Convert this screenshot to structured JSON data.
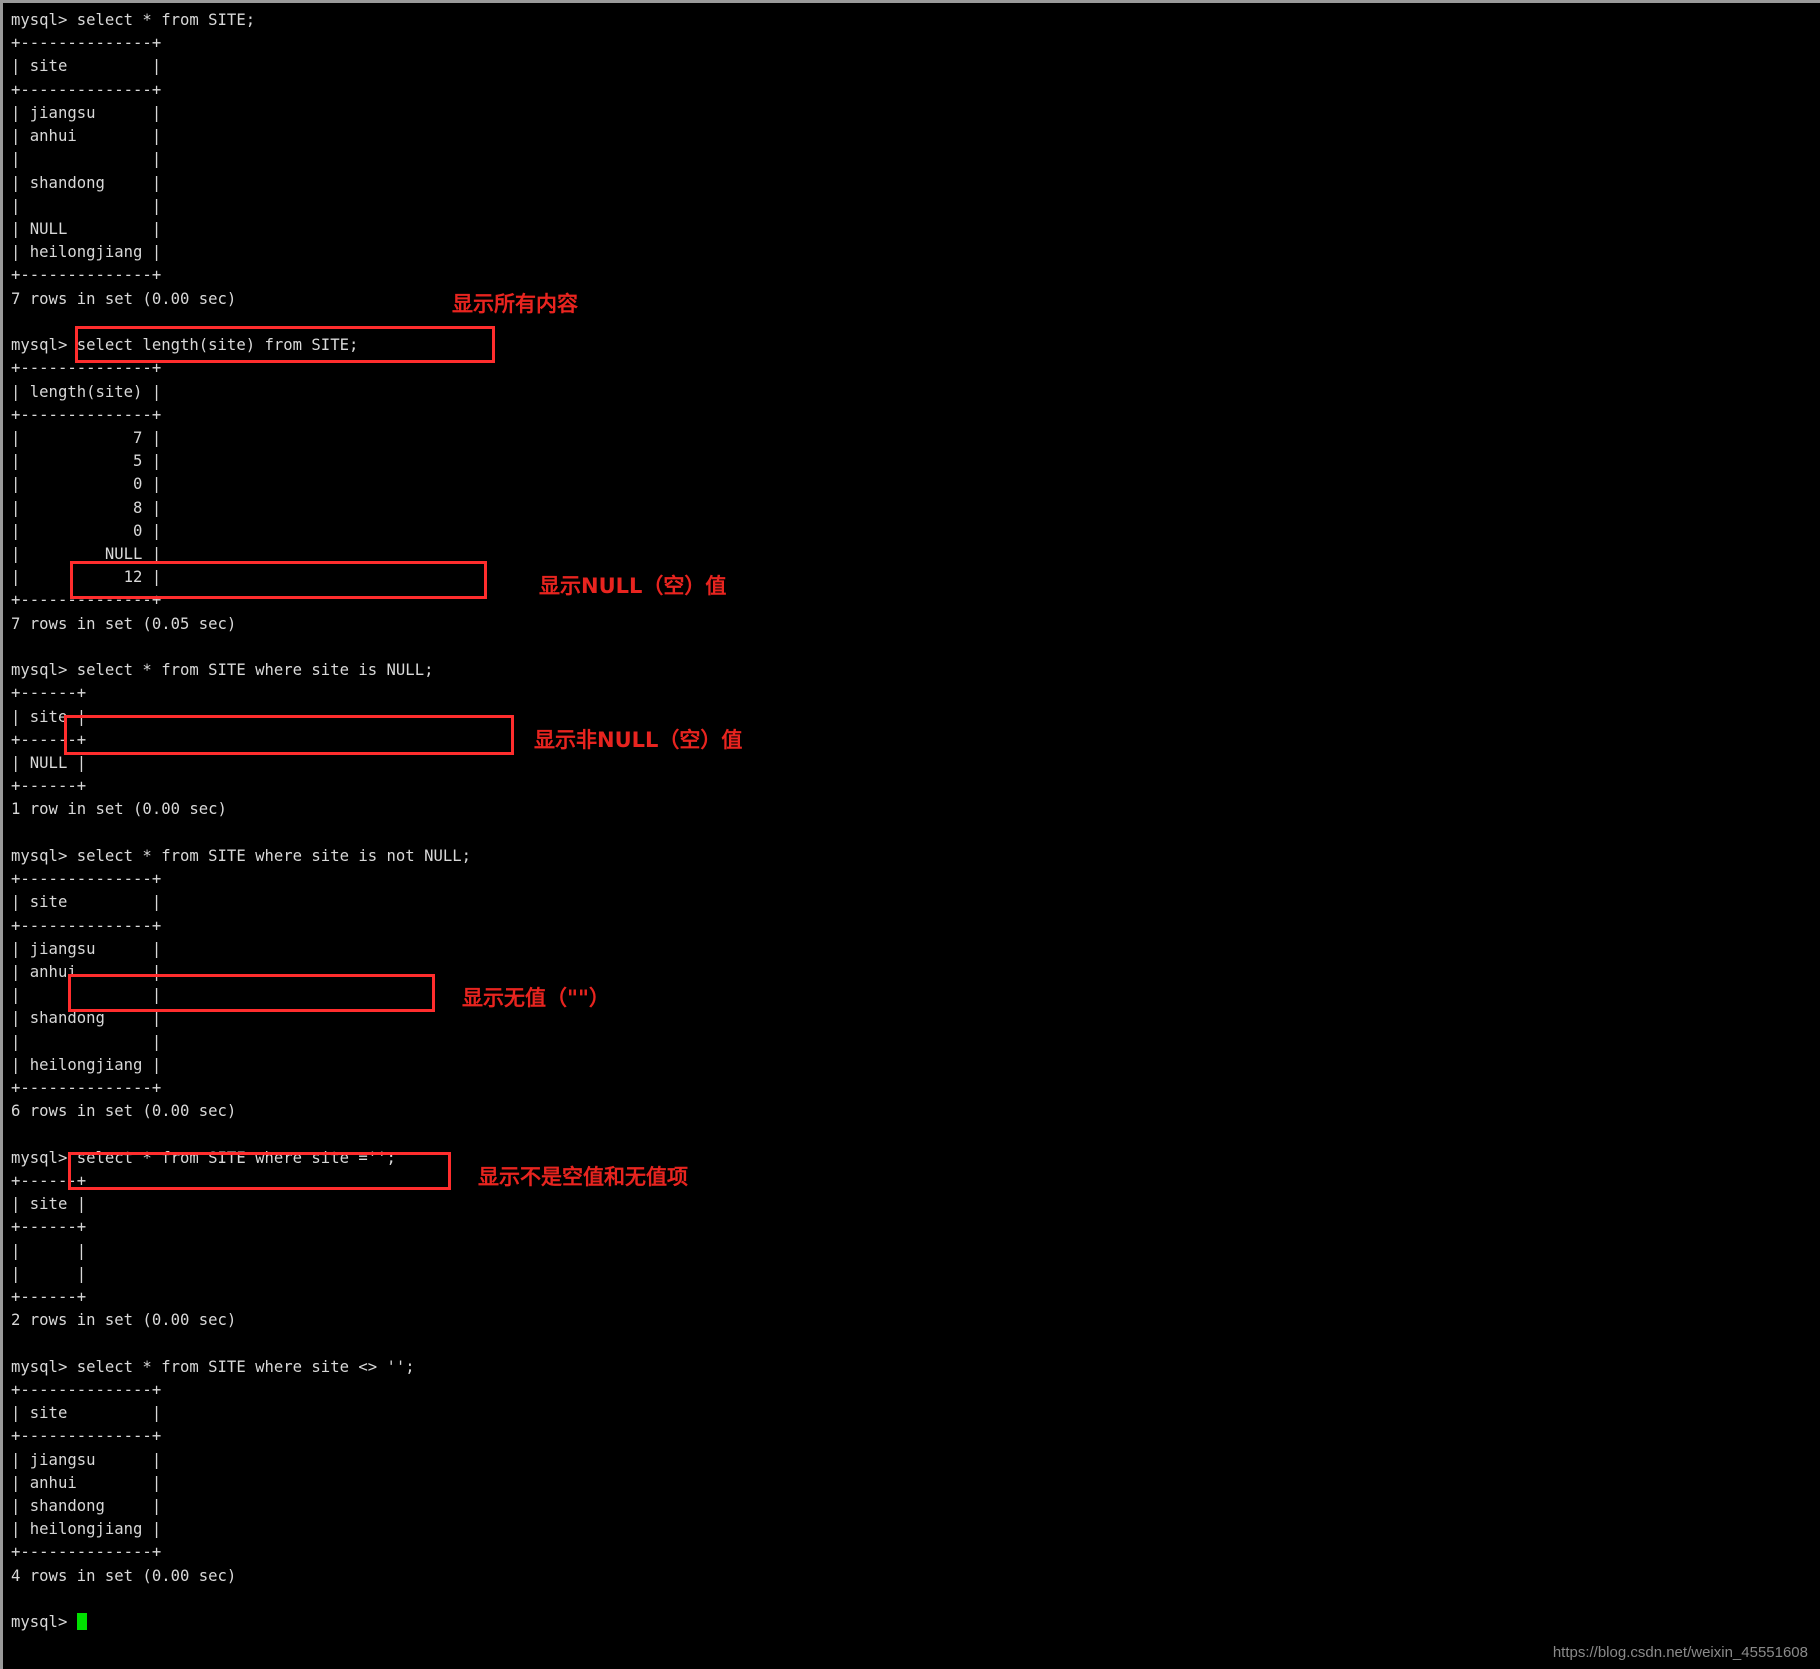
{
  "terminal": {
    "prompt": "mysql>",
    "cursor": "block-cursor",
    "lines": [
      "mysql> select * from SITE;",
      "+--------------+",
      "| site         |",
      "+--------------+",
      "| jiangsu      |",
      "| anhui        |",
      "|              |",
      "| shandong     |",
      "|              |",
      "| NULL         |",
      "| heilongjiang |",
      "+--------------+",
      "7 rows in set (0.00 sec)",
      "",
      "mysql> select length(site) from SITE;",
      "+--------------+",
      "| length(site) |",
      "+--------------+",
      "|            7 |",
      "|            5 |",
      "|            0 |",
      "|            8 |",
      "|            0 |",
      "|         NULL |",
      "|           12 |",
      "+--------------+",
      "7 rows in set (0.05 sec)",
      "",
      "mysql> select * from SITE where site is NULL;",
      "+------+",
      "| site |",
      "+------+",
      "| NULL |",
      "+------+",
      "1 row in set (0.00 sec)",
      "",
      "mysql> select * from SITE where site is not NULL;",
      "+--------------+",
      "| site         |",
      "+--------------+",
      "| jiangsu      |",
      "| anhui        |",
      "|              |",
      "| shandong     |",
      "|              |",
      "| heilongjiang |",
      "+--------------+",
      "6 rows in set (0.00 sec)",
      "",
      "mysql> select * from SITE where site ='';",
      "+------+",
      "| site |",
      "+------+",
      "|      |",
      "|      |",
      "+------+",
      "2 rows in set (0.00 sec)",
      "",
      "mysql> select * from SITE where site <> '';",
      "+--------------+",
      "| site         |",
      "+--------------+",
      "| jiangsu      |",
      "| anhui        |",
      "| shandong     |",
      "| heilongjiang |",
      "+--------------+",
      "4 rows in set (0.00 sec)",
      ""
    ],
    "final_prompt": "mysql> "
  },
  "annotations": [
    {
      "text": "显示所有内容",
      "color": "#e8241f"
    },
    {
      "text": "显示NULL（空）值",
      "color": "#e8241f"
    },
    {
      "text": "显示非NULL（空）值",
      "color": "#e8241f"
    },
    {
      "text": "显示无值（\"\"）",
      "color": "#e8241f"
    },
    {
      "text": "显示不是空值和无值项",
      "color": "#e8241f"
    }
  ],
  "highlight_boxes": [
    {
      "label": "select length(site) from SITE;"
    },
    {
      "label": "select * from SITE where site is NULL;"
    },
    {
      "label": "select * from SITE where site is not NULL;"
    },
    {
      "label": "select * from SITE where site ='';"
    },
    {
      "label": "select * from SITE where site <> '';"
    }
  ],
  "watermark": "https://blog.csdn.net/weixin_45551608",
  "colors": {
    "background": "#000000",
    "text": "#d8d8d8",
    "accent_red": "#ff2d2d",
    "cursor_green": "#00e000",
    "watermark": "#8a8a8a"
  }
}
